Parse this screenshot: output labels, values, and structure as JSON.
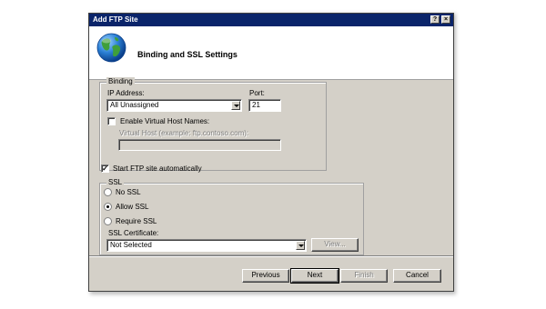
{
  "window": {
    "title": "Add FTP Site",
    "help_button": "?",
    "close_button": "×"
  },
  "header": {
    "page_title": "Binding and SSL Settings",
    "icon": "globe-icon"
  },
  "binding": {
    "group_label": "Binding",
    "ip_address_label": "IP Address:",
    "ip_address_value": "All Unassigned",
    "port_label": "Port:",
    "port_value": "21",
    "enable_virtual_host_label": "Enable Virtual Host Names:",
    "enable_virtual_host_checked": false,
    "virtual_host_label": "Virtual Host (example: ftp.contoso.com):",
    "virtual_host_value": ""
  },
  "start_automatically": {
    "label": "Start FTP site automatically",
    "checked": true
  },
  "ssl": {
    "group_label": "SSL",
    "options": [
      {
        "label": "No SSL",
        "checked": false
      },
      {
        "label": "Allow SSL",
        "checked": true
      },
      {
        "label": "Require SSL",
        "checked": false
      }
    ],
    "certificate_label": "SSL Certificate:",
    "certificate_value": "Not Selected",
    "view_button": "View..."
  },
  "footer": {
    "previous": "Previous",
    "next": "Next",
    "finish": "Finish",
    "cancel": "Cancel"
  }
}
